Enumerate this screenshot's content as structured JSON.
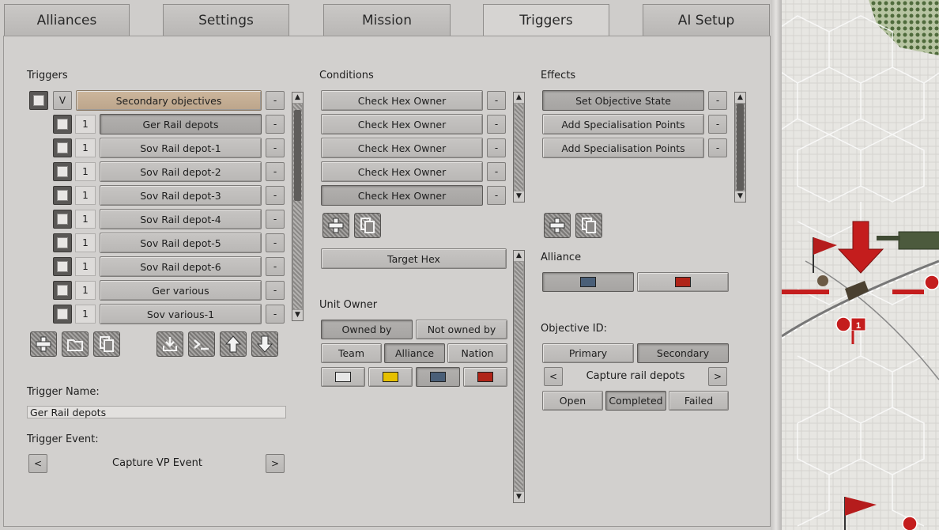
{
  "tabs": [
    {
      "label": "Alliances"
    },
    {
      "label": "Settings"
    },
    {
      "label": "Mission"
    },
    {
      "label": "Triggers"
    },
    {
      "label": "AI Setup"
    }
  ],
  "triggers": {
    "heading": "Triggers",
    "group": {
      "toggle": "V",
      "label": "Secondary objectives",
      "minus": "-"
    },
    "items": [
      {
        "order": "1",
        "label": "Ger Rail depots",
        "minus": "-"
      },
      {
        "order": "1",
        "label": "Sov Rail depot-1",
        "minus": "-"
      },
      {
        "order": "1",
        "label": "Sov Rail depot-2",
        "minus": "-"
      },
      {
        "order": "1",
        "label": "Sov Rail depot-3",
        "minus": "-"
      },
      {
        "order": "1",
        "label": "Sov Rail depot-4",
        "minus": "-"
      },
      {
        "order": "1",
        "label": "Sov Rail depot-5",
        "minus": "-"
      },
      {
        "order": "1",
        "label": "Sov Rail depot-6",
        "minus": "-"
      },
      {
        "order": "1",
        "label": "Ger various",
        "minus": "-"
      },
      {
        "order": "1",
        "label": "Sov various-1",
        "minus": "-"
      }
    ],
    "name_label": "Trigger Name:",
    "name_value": "Ger Rail depots",
    "event_label": "Trigger Event:",
    "event_value": "Capture VP Event",
    "prev": "<",
    "next": ">",
    "tools": [
      "plus-icon",
      "folder-icon",
      "copy-icon",
      "import-icon",
      "console-icon",
      "arrow-up-icon",
      "arrow-down-icon"
    ]
  },
  "conditions": {
    "heading": "Conditions",
    "items": [
      {
        "label": "Check Hex Owner",
        "minus": "-"
      },
      {
        "label": "Check Hex Owner",
        "minus": "-"
      },
      {
        "label": "Check Hex Owner",
        "minus": "-"
      },
      {
        "label": "Check Hex Owner",
        "minus": "-"
      },
      {
        "label": "Check Hex Owner",
        "minus": "-"
      }
    ],
    "target_hex": "Target Hex",
    "unit_owner_label": "Unit Owner",
    "owned_by": "Owned by",
    "not_owned_by": "Not owned by",
    "team": "Team",
    "alliance": "Alliance",
    "nation": "Nation",
    "colors": [
      "#e6e6e6",
      "#e6c000",
      "#4a5f78",
      "#b02418"
    ]
  },
  "effects": {
    "heading": "Effects",
    "items": [
      {
        "label": "Set Objective State",
        "minus": "-"
      },
      {
        "label": "Add Specialisation Points",
        "minus": "-"
      },
      {
        "label": "Add Specialisation Points",
        "minus": "-"
      }
    ],
    "alliance_label": "Alliance",
    "alliance_colors": [
      "#4a5f78",
      "#b02418"
    ],
    "objective_id_label": "Objective ID:",
    "primary": "Primary",
    "secondary": "Secondary",
    "objective_value": "Capture rail depots",
    "prev": "<",
    "next": ">",
    "open": "Open",
    "completed": "Completed",
    "failed": "Failed"
  },
  "map": {
    "unit_strength": "1"
  }
}
